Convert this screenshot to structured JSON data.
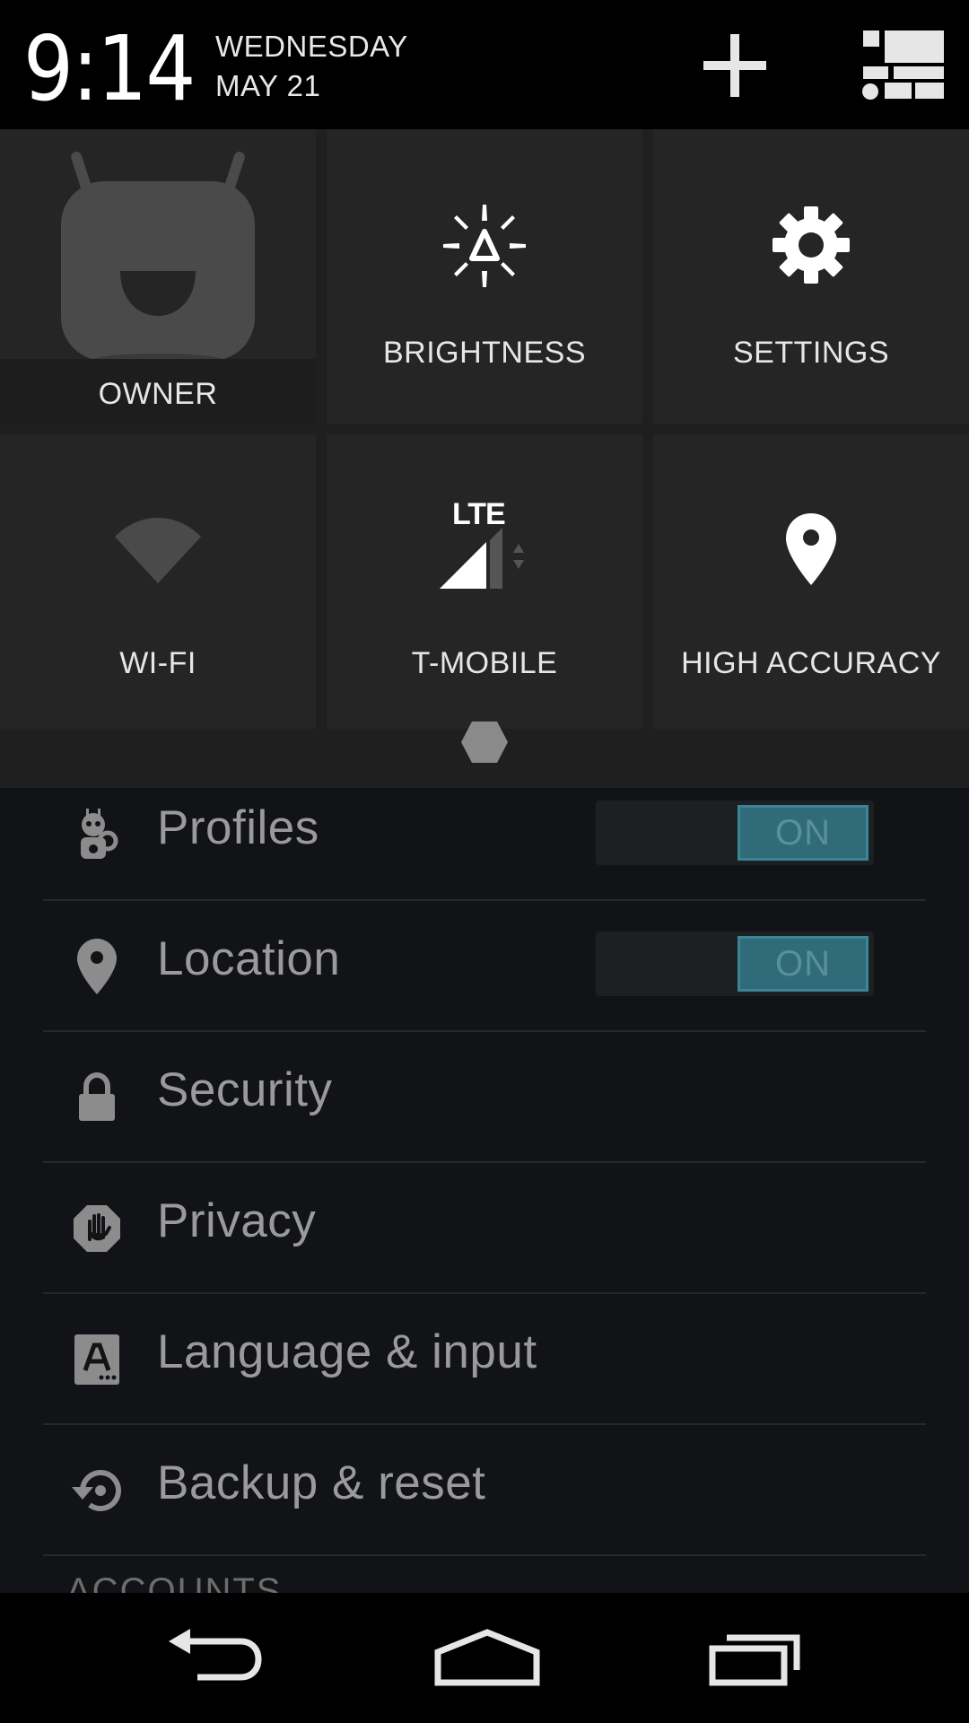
{
  "status": {
    "time": "9:14",
    "day": "WEDNESDAY",
    "date": "MAY 21"
  },
  "header_actions": {
    "add_icon": "plus-icon",
    "toggle_view_icon": "tiles-view-icon"
  },
  "quick_tiles": [
    {
      "label": "OWNER",
      "icon": "cyanogen-mascot-icon"
    },
    {
      "label": "BRIGHTNESS",
      "icon": "brightness-auto-icon"
    },
    {
      "label": "SETTINGS",
      "icon": "gear-icon"
    },
    {
      "label": "WI-FI",
      "icon": "wifi-icon"
    },
    {
      "label": "T-MOBILE",
      "icon": "lte-signal-icon",
      "network_type": "LTE"
    },
    {
      "label": "HIGH ACCURACY",
      "icon": "location-pin-icon"
    }
  ],
  "settings_list": [
    {
      "label": "Profiles",
      "icon": "profiles-icon",
      "toggle": "ON"
    },
    {
      "label": "Location",
      "icon": "location-icon",
      "toggle": "ON"
    },
    {
      "label": "Security",
      "icon": "lock-icon"
    },
    {
      "label": "Privacy",
      "icon": "privacy-hand-icon"
    },
    {
      "label": "Language & input",
      "icon": "keyboard-a-icon"
    },
    {
      "label": "Backup & reset",
      "icon": "backup-restore-icon"
    }
  ],
  "section_header": "ACCOUNTS",
  "colors": {
    "toggle_on": "#2f6b79",
    "tile_bg": "#252525",
    "list_bg": "#111316"
  }
}
